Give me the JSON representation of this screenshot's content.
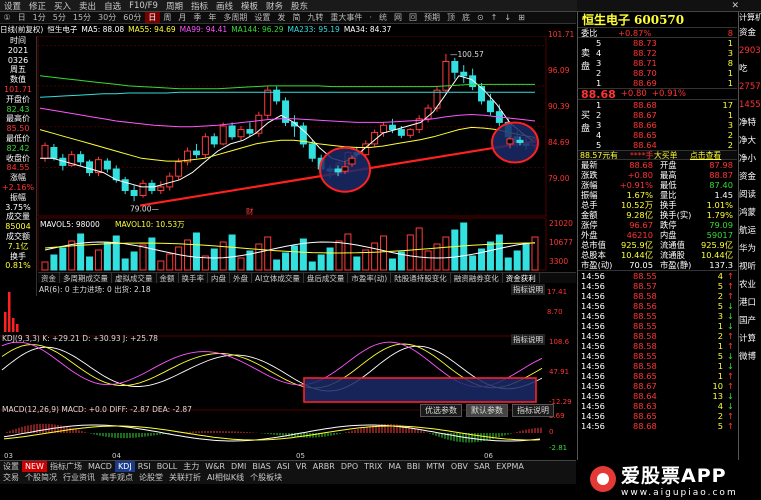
{
  "topbar": [
    "设置",
    "修正",
    "买入",
    "卖出",
    "自选",
    "F10/F9",
    "周期",
    "指标",
    "画线",
    "模板",
    "财务",
    "股东"
  ],
  "menubar": {
    "items": [
      "①",
      "日",
      "1分",
      "5分",
      "15分",
      "30分",
      "60分",
      "日",
      "周",
      "月",
      "季",
      "年",
      "多周期",
      "设置",
      "发",
      "简",
      "九转",
      "重大事件",
      "·",
      "统",
      "网",
      "回",
      "预期",
      "顶",
      "底",
      "⊙",
      "↑",
      "↓",
      "⊞"
    ],
    "selected": 7
  },
  "left_panel": [
    {
      "t": "时间",
      "c": "white"
    },
    {
      "t": "2021",
      "c": "white"
    },
    {
      "t": "0326",
      "c": "white"
    },
    {
      "t": "周五",
      "c": "white"
    },
    {
      "t": "数值",
      "c": "white"
    },
    {
      "t": "101.71",
      "c": "red"
    },
    {
      "t": "开盘价",
      "c": "white"
    },
    {
      "t": "82.43",
      "c": "green"
    },
    {
      "t": "最高价",
      "c": "white"
    },
    {
      "t": "85.50",
      "c": "red"
    },
    {
      "t": "最低价",
      "c": "white"
    },
    {
      "t": "82.42",
      "c": "green"
    },
    {
      "t": "收盘价",
      "c": "white"
    },
    {
      "t": "84.55",
      "c": "red"
    },
    {
      "t": "涨幅",
      "c": "white"
    },
    {
      "t": "+2.16%",
      "c": "red"
    },
    {
      "t": "振幅",
      "c": "white"
    },
    {
      "t": "3.75%",
      "c": "white"
    },
    {
      "t": "成交量",
      "c": "white"
    },
    {
      "t": "85004",
      "c": "yellow"
    },
    {
      "t": "成交额",
      "c": "white"
    },
    {
      "t": "7.1亿",
      "c": "yellow"
    },
    {
      "t": "换手",
      "c": "white"
    },
    {
      "t": "0.81%",
      "c": "yellow"
    }
  ],
  "ma_line": [
    {
      "t": "日线(前复权)",
      "c": "white"
    },
    {
      "t": "恒生电子",
      "c": "white"
    },
    {
      "t": "MA5: 88.08",
      "c": "white"
    },
    {
      "t": "MA55: 94.69",
      "c": "yellow"
    },
    {
      "t": "MA99: 94.41",
      "c": "magenta"
    },
    {
      "t": "MA144: 96.29",
      "c": "green"
    },
    {
      "t": "MA233: 95.19",
      "c": "cyan"
    },
    {
      "t": "MA34: 84.37",
      "c": "white"
    }
  ],
  "price_axis": [
    "101.71",
    "96.09",
    "90.39",
    "84.69",
    "79.00"
  ],
  "annot_high": "100.57",
  "annot_low": "79.00",
  "annot_fin": "财",
  "vol_label": {
    "title": "MAVOL5: 98000",
    "ma10": "MAVOL10: 10.53万"
  },
  "vol_axis": [
    "21020",
    "10677",
    "3300"
  ],
  "btn_row1": [
    "资金",
    "多周期成交量",
    "虚拟成交量",
    "金额",
    "换手率",
    "内盘",
    "外盘",
    "AI立体成交量",
    "盘后成交量",
    "市盈率(动)",
    "陆股通持股变化",
    "融资融券变化"
  ],
  "btn_row1_extra": "资金获利",
  "ar_label": "AR(6): 0  主力进场: 0  出货: 2.18",
  "ar_axis": [
    "17.41",
    "8.70"
  ],
  "kdj_label": "KDJ(9,3,3) K: +29.21  D: +30.93  J: +25.78",
  "kdj_axis": [
    "108.6",
    "47.91",
    "-12.29"
  ],
  "kdj_btns": [
    "优选参数",
    "默认参数",
    "指标说明"
  ],
  "macd_label": "MACD(12,26,9)  MACD: +0.0  DIFF: -2.87  DEA: -2.87",
  "macd_axis": [
    "2.69",
    "0",
    "-2.81"
  ],
  "date_axis": [
    "03",
    "04",
    "05",
    "06"
  ],
  "indicator_tabs": [
    "设置",
    "NEW",
    "指标广场",
    "MACD",
    "KDJ",
    "RSI",
    "BOLL",
    "主力",
    "W&R",
    "DMI",
    "BIAS",
    "ASI",
    "VR",
    "ARBR",
    "DPO",
    "TRIX",
    "MA",
    "BBI",
    "MTM",
    "OBV",
    "SAR",
    "EXPMA"
  ],
  "indicator_selected": "KDJ",
  "bottom_tabs2": [
    "交易",
    "个股简况",
    "行业资讯",
    "高手观点",
    "论股堂",
    "关联打折",
    "AI相似K线",
    "个股板块"
  ],
  "stock": {
    "name": "恒生电子",
    "code": "600570",
    "price": "88.68",
    "change": "+0.80",
    "pct": "+0.91%",
    "weibi_label": "委比",
    "weibi": "+0.87%",
    "weicha": "8"
  },
  "ask": [
    {
      "n": "5",
      "p": "88.73",
      "v": "1"
    },
    {
      "n": "4",
      "p": "88.72",
      "v": "3"
    },
    {
      "n": "3",
      "p": "88.71",
      "v": "8"
    },
    {
      "n": "2",
      "p": "88.70",
      "v": "1"
    },
    {
      "n": "1",
      "p": "88.69",
      "v": "1"
    }
  ],
  "bid": [
    {
      "n": "1",
      "p": "88.68",
      "v": "17"
    },
    {
      "n": "2",
      "p": "88.67",
      "v": "1"
    },
    {
      "n": "3",
      "p": "88.66",
      "v": "3"
    },
    {
      "n": "4",
      "p": "88.65",
      "v": "2"
    },
    {
      "n": "5",
      "p": "88.64",
      "v": "2"
    }
  ],
  "side_labels": {
    "sell": "卖盘",
    "buy": "买盘"
  },
  "inout": {
    "left": "88.57元有",
    "mid": "****手",
    "right": "大买单",
    "link": "点击查看"
  },
  "stats": [
    [
      "最新",
      "88.68",
      "开盘",
      "87.98"
    ],
    [
      "涨跌",
      "+0.80",
      "最高",
      "88.87"
    ],
    [
      "涨幅",
      "+0.91%",
      "最低",
      "87.40"
    ],
    [
      "振幅",
      "1.67%",
      "量比",
      "1.45"
    ],
    [
      "总手",
      "10.52万",
      "换手",
      "1.01%"
    ],
    [
      "金额",
      "9.28亿",
      "换手(实)",
      "1.79%"
    ],
    [
      "涨停",
      "96.67",
      "跌停",
      "79.09"
    ],
    [
      "外盘",
      "46210",
      "内盘",
      "59017"
    ],
    [
      "总市值",
      "925.9亿",
      "流通值",
      "925.9亿"
    ],
    [
      "总股本",
      "10.44亿",
      "流通股",
      "10.44亿"
    ],
    [
      "市盈(动)",
      "70.05",
      "市盈(静)",
      "137.3"
    ]
  ],
  "ticks": [
    [
      "14:56",
      "88.55",
      "4",
      "↑"
    ],
    [
      "14:56",
      "88.57",
      "5",
      "↑"
    ],
    [
      "14:56",
      "88.58",
      "2",
      "↑"
    ],
    [
      "14:56",
      "88.56",
      "5",
      "↓"
    ],
    [
      "14:56",
      "88.55",
      "3",
      "↓"
    ],
    [
      "14:56",
      "88.55",
      "1",
      "↓"
    ],
    [
      "14:56",
      "88.58",
      "2",
      "↑"
    ],
    [
      "14:56",
      "88.58",
      "1",
      "↑"
    ],
    [
      "14:56",
      "88.55",
      "5",
      "↓"
    ],
    [
      "14:56",
      "88.58",
      "1",
      "↓"
    ],
    [
      "14:56",
      "88.65",
      "1",
      "↑"
    ],
    [
      "14:56",
      "88.67",
      "10",
      "↑"
    ],
    [
      "14:56",
      "88.64",
      "13",
      "↓"
    ],
    [
      "14:56",
      "88.63",
      "4",
      "↓"
    ],
    [
      "14:56",
      "88.65",
      "2",
      "↑"
    ],
    [
      "14:56",
      "88.68",
      "5",
      "↑"
    ]
  ],
  "farright": {
    "top": "计算机",
    "items": [
      "资金",
      "2903",
      "吃",
      "2757",
      "1455",
      "净特",
      "净大",
      "净小",
      "资金",
      "阅读",
      "鸿蒙",
      "航运",
      "华为",
      "视听",
      "农业",
      "港口",
      "国产",
      "计算",
      "微博"
    ]
  },
  "brand": {
    "name": "爱股票APP",
    "url": "www.aigupiao.com"
  }
}
